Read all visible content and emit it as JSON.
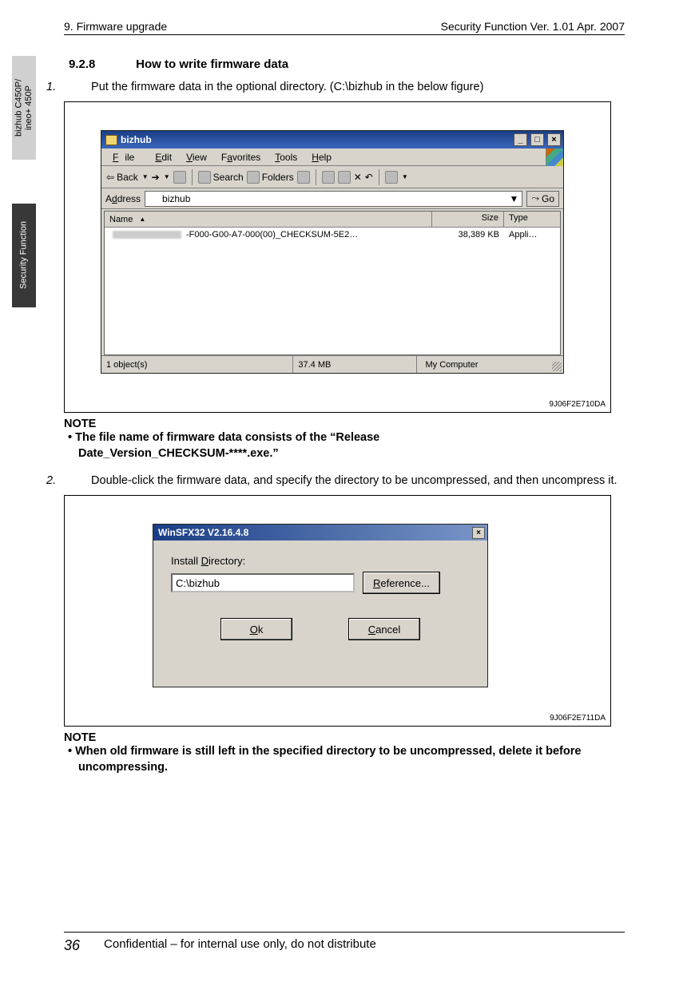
{
  "header": {
    "left": "9. Firmware upgrade",
    "right": "Security Function Ver. 1.01 Apr. 2007"
  },
  "sidetabs": {
    "light": "bizhub C450P/\nineo+ 450P",
    "dark": "Security Function"
  },
  "sec": {
    "num": "9.2.8",
    "title": "How to write firmware data"
  },
  "steps": {
    "s1": {
      "n": "1.",
      "text": "Put the firmware data in the optional directory. (C:\\bizhub in the below figure)"
    },
    "s2": {
      "n": "2.",
      "text": "Double-click the firmware data, and specify the directory to be uncompressed, and then uncompress it."
    }
  },
  "notes": {
    "n1h": "NOTE",
    "n1b": "The file name of firmware data consists of the “Release Date_Version_CHECKSUM-****.exe.”",
    "n2h": "NOTE",
    "n2b": "When old firmware is still left in the specified directory to be uncompressed, delete it before uncompressing."
  },
  "fig1": {
    "code": "9J06F2E710DA",
    "title": "bizhub",
    "menu_file": "File",
    "menu_edit": "Edit",
    "menu_view": "View",
    "menu_fav": "Favorites",
    "menu_tools": "Tools",
    "menu_help": "Help",
    "tb_back": "Back",
    "tb_search": "Search",
    "tb_folders": "Folders",
    "addr_label": "Address",
    "addr_value": "bizhub",
    "go": "Go",
    "col_name": "Name",
    "col_size": "Size",
    "col_type": "Type",
    "row_suffix": "-F000-G00-A7-000(00)_CHECKSUM-5E2…",
    "row_size": "38,389 KB",
    "row_type": "Appli…",
    "status_objs": "1 object(s)",
    "status_size": "37.4 MB",
    "status_loc": "My Computer"
  },
  "fig2": {
    "code": "9J06F2E711DA",
    "title": "WinSFX32 V2.16.4.8",
    "lbl": "Install Directory:",
    "value": "C:\\bizhub",
    "ref": "Reference...",
    "ok": "Ok",
    "cancel": "Cancel"
  },
  "footer": {
    "page": "36",
    "conf": "Confidential – for internal use only, do not distribute"
  }
}
